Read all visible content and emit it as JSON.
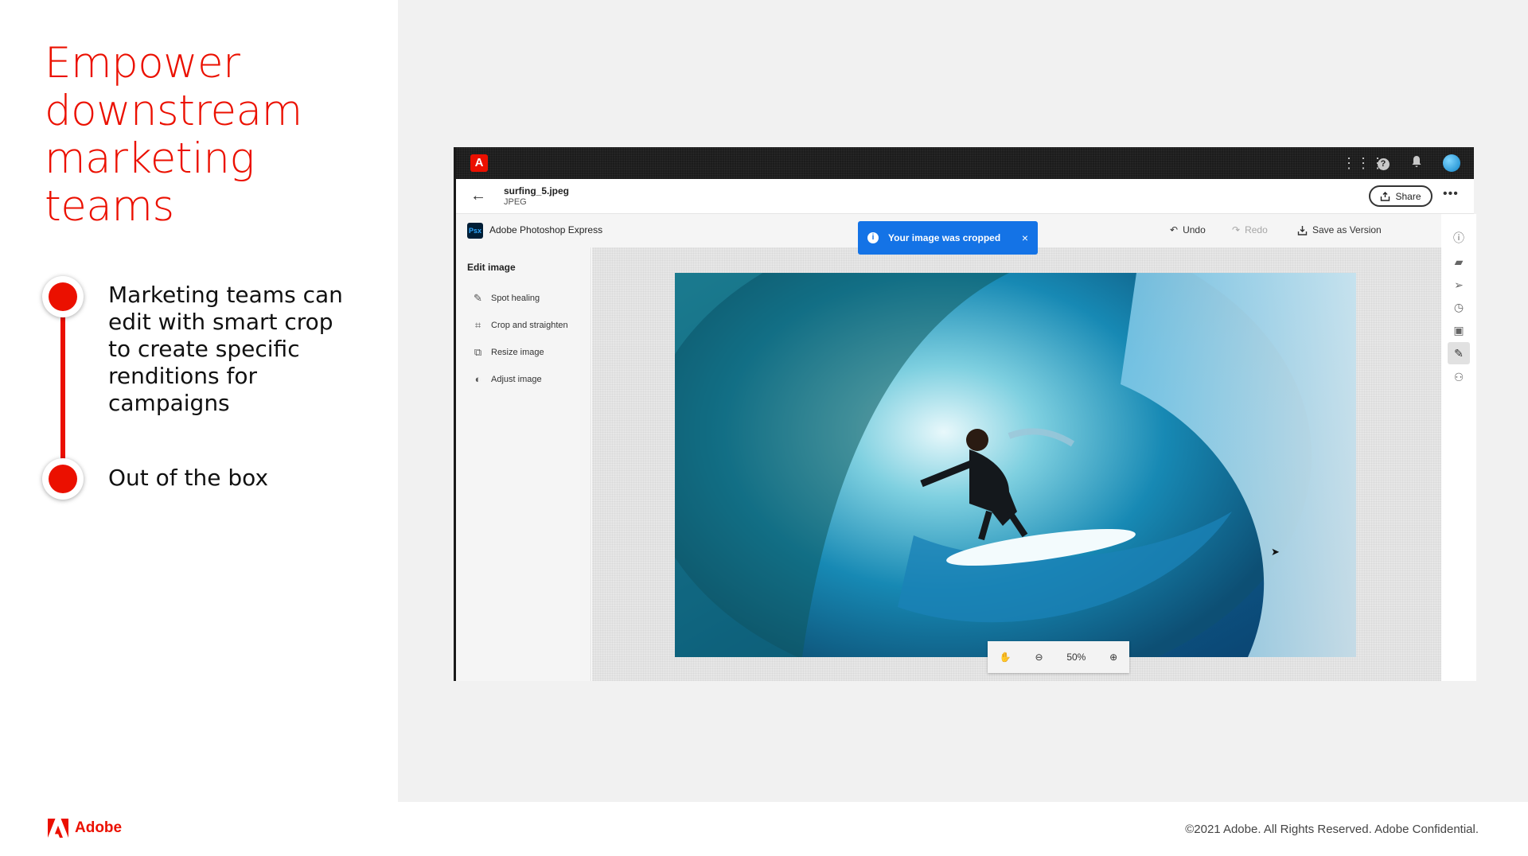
{
  "slide": {
    "title": "Empower downstream marketing teams",
    "bullets": [
      "Marketing teams can edit with smart crop to create specific renditions for campaigns",
      "Out of the box"
    ]
  },
  "footer": {
    "brand": "Adobe",
    "copyright": "©2021 Adobe. All Rights Reserved. Adobe Confidential."
  },
  "app": {
    "logo_letter": "A",
    "file": {
      "name": "surfing_5.jpeg",
      "type": "JPEG"
    },
    "share_label": "Share",
    "more_label": "•••",
    "product": {
      "badge": "Psx",
      "name": "Adobe Photoshop Express"
    },
    "toast": {
      "message": "Your image was cropped",
      "close": "×",
      "info": "i"
    },
    "actions": {
      "undo": "Undo",
      "redo": "Redo",
      "save_version": "Save as Version"
    },
    "sidebar": {
      "title": "Edit image",
      "items": [
        "Spot healing",
        "Crop and straighten",
        "Resize image",
        "Adjust image"
      ]
    },
    "zoom": {
      "level": "50%"
    },
    "icons": {
      "topbar": [
        "grid-icon",
        "help-icon",
        "bell-icon",
        "avatar"
      ],
      "rail": [
        "info-icon",
        "comment-icon",
        "send-icon",
        "history-icon",
        "image-icon",
        "edit-icon",
        "person-icon"
      ]
    },
    "colors": {
      "accent": "#eb1000",
      "toast": "#1473e6",
      "topbar": "#1c1c1c"
    }
  }
}
